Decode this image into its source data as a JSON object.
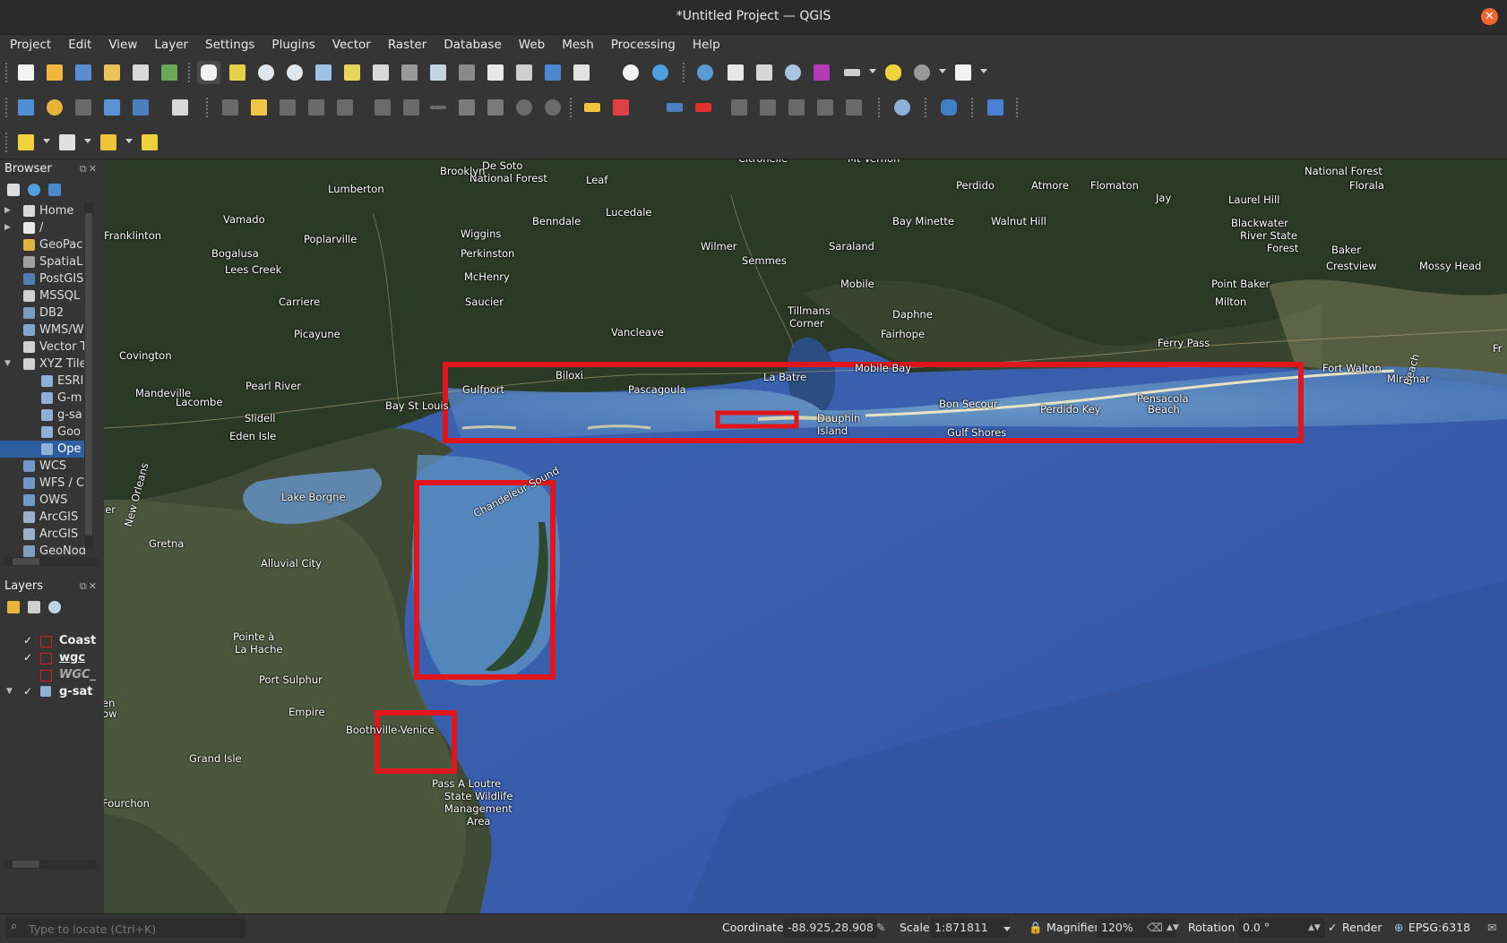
{
  "window": {
    "title": "*Untitled Project — QGIS",
    "close_glyph": "✕"
  },
  "menu": [
    "Project",
    "Edit",
    "View",
    "Layer",
    "Settings",
    "Plugins",
    "Vector",
    "Raster",
    "Database",
    "Web",
    "Mesh",
    "Processing",
    "Help"
  ],
  "browser": {
    "title": "Browser",
    "items": [
      {
        "label": "Home",
        "icon": "home-icon",
        "arrow": "▶"
      },
      {
        "label": "/",
        "icon": "folder-icon",
        "arrow": "▶"
      },
      {
        "label": "GeoPac",
        "icon": "geopackage-icon"
      },
      {
        "label": "SpatiaL",
        "icon": "spatialite-icon"
      },
      {
        "label": "PostGIS",
        "icon": "postgis-icon"
      },
      {
        "label": "MSSQL",
        "icon": "mssql-icon"
      },
      {
        "label": "DB2",
        "icon": "db2-icon"
      },
      {
        "label": "WMS/W",
        "icon": "wms-icon"
      },
      {
        "label": "Vector T",
        "icon": "vector-tiles-icon"
      },
      {
        "label": "XYZ Tile",
        "icon": "xyz-tiles-icon",
        "arrow": "▼"
      },
      {
        "label": "ESRI",
        "icon": "tile-grid-icon",
        "child": true
      },
      {
        "label": "G-m",
        "icon": "tile-grid-icon",
        "child": true
      },
      {
        "label": "g-sa",
        "icon": "tile-grid-icon",
        "child": true
      },
      {
        "label": "Goo",
        "icon": "tile-grid-icon",
        "child": true
      },
      {
        "label": "Ope",
        "icon": "tile-grid-icon",
        "child": true,
        "selected": true
      },
      {
        "label": "WCS",
        "icon": "wcs-icon"
      },
      {
        "label": "WFS / C",
        "icon": "wfs-icon"
      },
      {
        "label": "OWS",
        "icon": "ows-icon"
      },
      {
        "label": "ArcGIS",
        "icon": "arcgis-icon"
      },
      {
        "label": "ArcGIS",
        "icon": "arcgis-icon"
      },
      {
        "label": "GeoNod",
        "icon": "geonode-icon"
      }
    ]
  },
  "layers": {
    "title": "Layers",
    "items": [
      {
        "label": "Coast",
        "checked": "✓",
        "type": "polygon"
      },
      {
        "label": "wgc",
        "checked": "✓",
        "type": "polygon",
        "underline": true
      },
      {
        "label": "WGC_",
        "checked": "",
        "type": "polygon",
        "italic": true
      },
      {
        "label": "g-sat",
        "checked": "✓",
        "type": "raster",
        "arrow": "▼"
      }
    ]
  },
  "map": {
    "labels": [
      "De Soto",
      "National Forest",
      "Brooklyn",
      "Leaf",
      "Citronelle",
      "Mt Vernon",
      "National Forest",
      "Lumberton",
      "Perdido",
      "Atmore",
      "Flomaton",
      "Jay",
      "Laurel Hill",
      "Florala",
      "Vamado",
      "Lucedale",
      "Bay Minette",
      "Walnut Hill",
      "Blackwater",
      "River State",
      "Forest",
      "Franklinton",
      "Poplarville",
      "Wiggins",
      "Benndale",
      "Wilmer",
      "Saraland",
      "Bogalusa",
      "Lees Creek",
      "Perkinston",
      "Semmes",
      "Baker",
      "Crestview",
      "Mossy Head",
      "McHenry",
      "Mobile",
      "Point Baker",
      "Saucier",
      "Milton",
      "Carriere",
      "Tillmans",
      "Corner",
      "Daphne",
      "Picayune",
      "Fairhope",
      "Vancleave",
      "Ferry Pass",
      "Covington",
      "Fort Walton",
      "Mandeville",
      "Pearl River",
      "Gulfport",
      "Biloxi",
      "Pascagoula",
      "La Batre",
      "Mobile Bay",
      "Miramar",
      "Beach",
      "Lacombe",
      "Bay St Louis",
      "Bon Secour",
      "Perdido Key",
      "Pensacola",
      "Beach",
      "Slidell",
      "Gulf Shores",
      "Dauphin",
      "Island",
      "Eden Isle",
      "Lake Borgne",
      "Chandeleur Sound",
      "New Orleans",
      "Gretna",
      "Alluvial City",
      "Pointe à",
      "La Hache",
      "Port Sulphur",
      "Empire",
      "Boothville-Venice",
      "Grand Isle",
      "Fourchon",
      "Pass A Loutre",
      "State Wildlife",
      "Management",
      "Area",
      "ier",
      "en",
      "ow",
      "Fr"
    ],
    "highlight_color": "#e0161c"
  },
  "status": {
    "locate_placeholder": "Type to locate (Ctrl+K)",
    "coordinate_label": "Coordinate",
    "coordinate_value": "-88.925,28.908",
    "scale_label": "Scale",
    "scale_value": "1:871811",
    "magnifier_label": "Magnifier",
    "magnifier_value": "120%",
    "rotation_label": "Rotation",
    "rotation_value": "0.0 °",
    "render_label": "Render",
    "render_checked": "✓",
    "crs": "EPSG:6318"
  }
}
